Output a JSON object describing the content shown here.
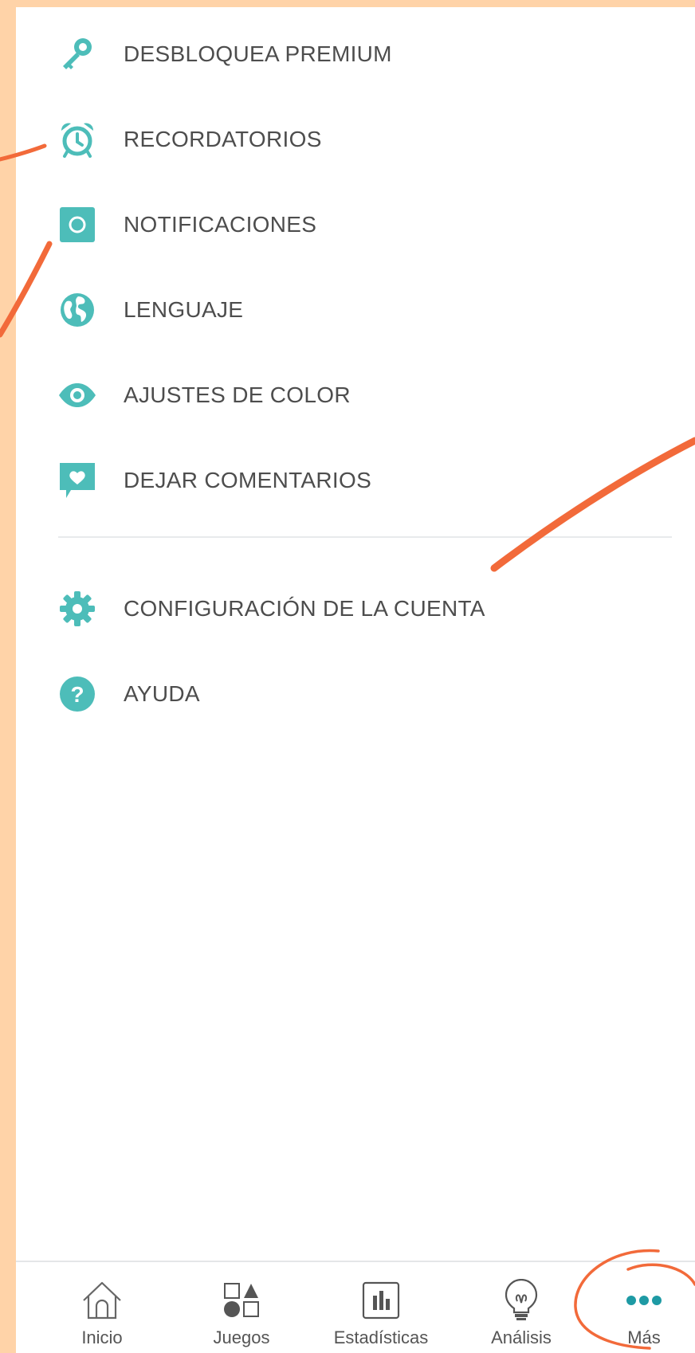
{
  "menu": {
    "items": [
      {
        "label": "DESBLOQUEA PREMIUM",
        "icon": "key-icon"
      },
      {
        "label": "RECORDATORIOS",
        "icon": "alarm-clock-icon"
      },
      {
        "label": "NOTIFICACIONES",
        "icon": "notification-square-icon"
      },
      {
        "label": "LENGUAJE",
        "icon": "globe-icon"
      },
      {
        "label": "AJUSTES DE COLOR",
        "icon": "eye-icon"
      },
      {
        "label": "DEJAR COMENTARIOS",
        "icon": "heart-speech-bubble-icon"
      }
    ],
    "secondary_items": [
      {
        "label": "CONFIGURACIÓN DE LA CUENTA",
        "icon": "gear-icon"
      },
      {
        "label": "AYUDA",
        "icon": "question-icon"
      }
    ]
  },
  "tabbar": {
    "tabs": [
      {
        "label": "Inicio",
        "icon": "home-icon"
      },
      {
        "label": "Juegos",
        "icon": "shapes-icon"
      },
      {
        "label": "Estadísticas",
        "icon": "bar-chart-icon"
      },
      {
        "label": "Análisis",
        "icon": "lightbulb-icon"
      },
      {
        "label": "Más",
        "icon": "more-dots-icon",
        "active": true
      }
    ]
  },
  "colors": {
    "accent": "#4dbdb9",
    "background_frame": "#ffd3a8",
    "annotation": "#f26a3a",
    "text": "#4d4d4d"
  }
}
